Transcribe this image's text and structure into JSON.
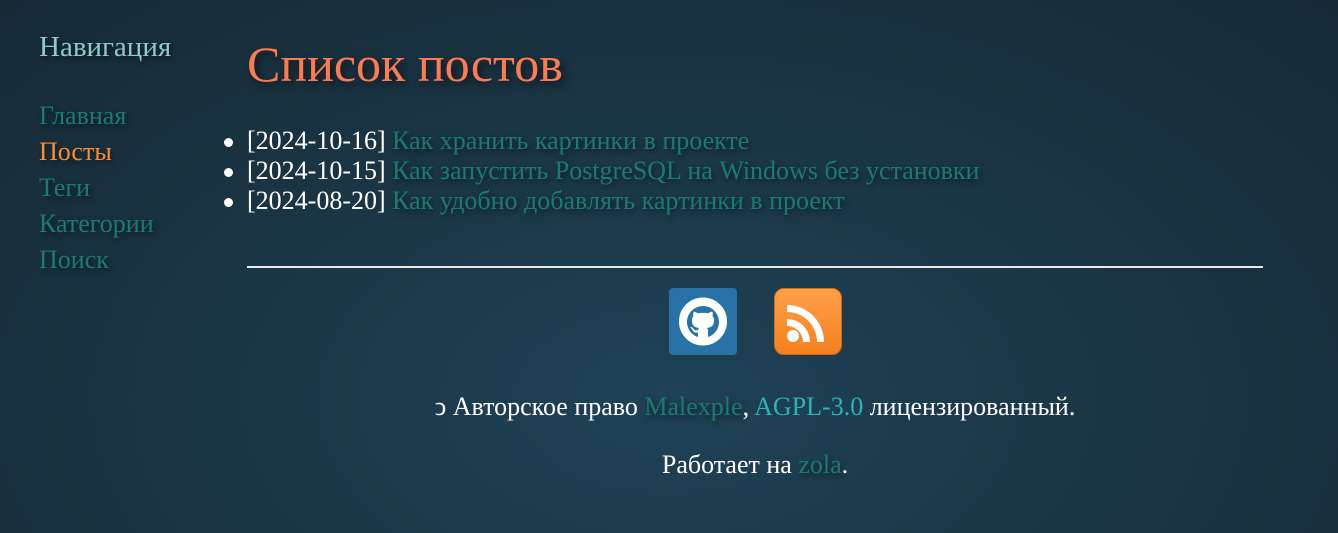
{
  "sidebar": {
    "title": "Навигация",
    "items": [
      {
        "label": "Главная"
      },
      {
        "label": "Посты"
      },
      {
        "label": "Теги"
      },
      {
        "label": "Категории"
      },
      {
        "label": "Поиск"
      }
    ],
    "active_item": "Посты"
  },
  "main": {
    "title": "Список постов",
    "posts": [
      {
        "date": "[2024-10-16]",
        "title": "Как хранить картинки в проекте"
      },
      {
        "date": "[2024-10-15]",
        "title": "Как запустить PostgreSQL на Windows без установки"
      },
      {
        "date": "[2024-08-20]",
        "title": "Как удобно добавлять картинки в проект"
      }
    ]
  },
  "social": {
    "github_icon": "github-icon",
    "rss_icon": "rss-icon"
  },
  "footer": {
    "copyright_symbol": "ↄ",
    "copyright_text": "Авторское право",
    "author": "Malexple",
    "comma": ",",
    "license": "AGPL-3.0",
    "licensed_text": "лицензированный.",
    "powered_text": "Работает на",
    "engine": "zola",
    "period": "."
  },
  "colors": {
    "accent_orange": "#ff7a50",
    "active_nav": "#ff8c2e",
    "link_teal": "#1c7a74",
    "link_bright": "#2ab4b4",
    "github_bg": "#2872a6",
    "rss_bg": "#f5801e"
  }
}
